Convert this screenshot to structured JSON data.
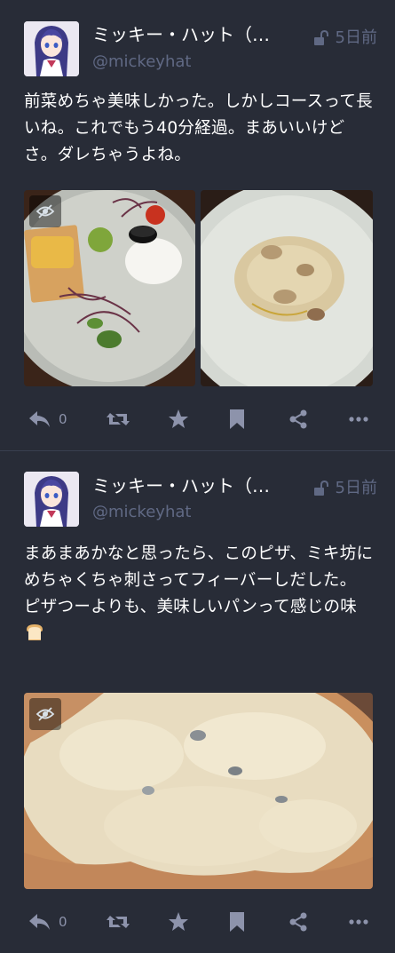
{
  "posts": [
    {
      "display_name": "ミッキー・ハット（宗…",
      "handle": "@mickeyhat",
      "time": "5日前",
      "visibility_icon": "unlock-icon",
      "content": [
        "前菜めちゃ美味しかった。しかしコースって長いね。これでもう40分経過。まあいいけどさ。ダレちゃうよね。"
      ],
      "media": [
        "appetizer-plate-image",
        "risotto-image"
      ],
      "reply_count": "0"
    },
    {
      "display_name": "ミッキー・ハット（宗…",
      "handle": "@mickeyhat",
      "time": "5日前",
      "visibility_icon": "unlock-icon",
      "content": [
        "まあまあかなと思ったら、このピザ、ミキ坊にめちゃくちゃ刺さってフィーバーしだした。",
        "ピザつーよりも、美味しいパンって感じの味"
      ],
      "media": [
        "pizza-image"
      ],
      "reply_count": "0"
    }
  ],
  "colors": {
    "background": "#282c37",
    "muted": "#606984",
    "icon": "#8d93ab",
    "text": "#ffffff"
  }
}
